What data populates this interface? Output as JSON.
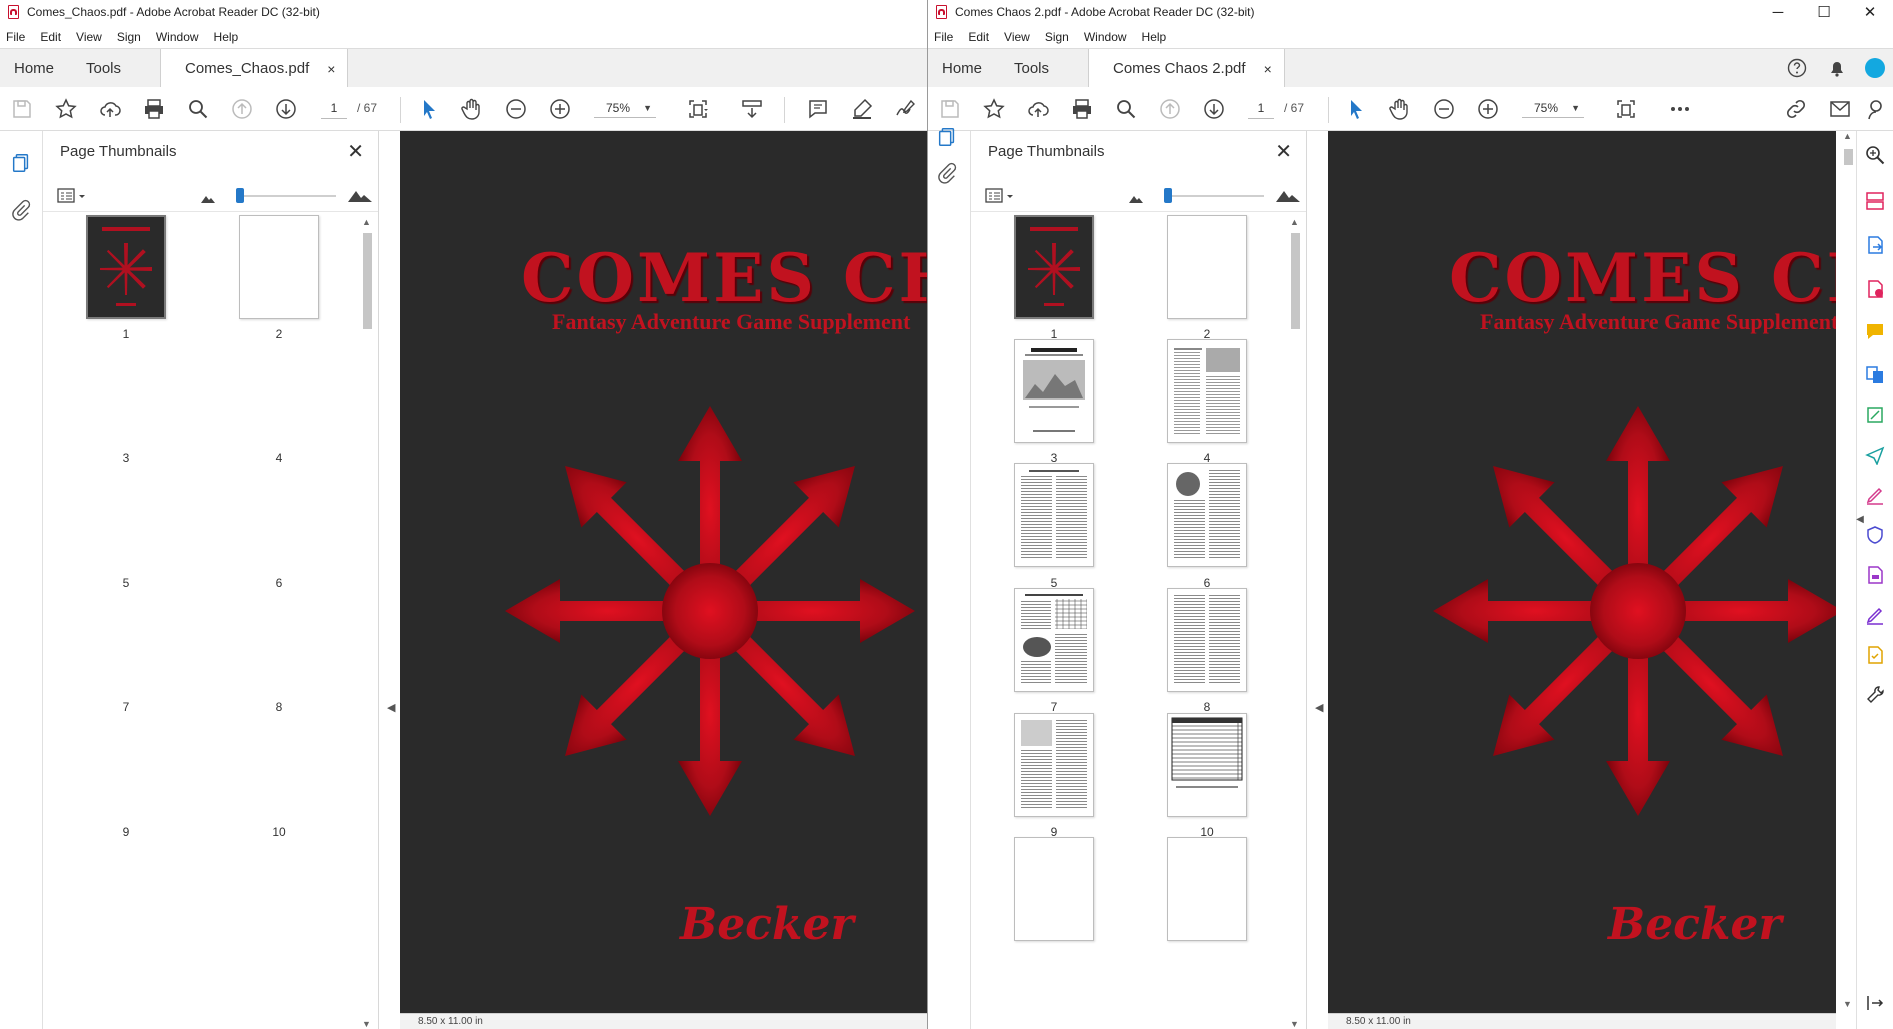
{
  "colors": {
    "accent_blue": "#2478c8",
    "cover_red": "#c1121f",
    "cover_bg": "#2a2a2a"
  },
  "left_window": {
    "title": "Comes_Chaos.pdf - Adobe Acrobat Reader DC (32-bit)",
    "menu": [
      "File",
      "Edit",
      "View",
      "Sign",
      "Window",
      "Help"
    ],
    "tabs": {
      "home": "Home",
      "tools": "Tools",
      "doc": "Comes_Chaos.pdf",
      "close": "×"
    },
    "toolbar": {
      "page_current": "1",
      "page_total": "/ 67",
      "zoom": "75%"
    },
    "panel": {
      "title": "Page Thumbnails",
      "close": "✕",
      "thumbnails": [
        "1",
        "2",
        "3",
        "4",
        "5",
        "6",
        "7",
        "8",
        "9",
        "10"
      ]
    },
    "cover": {
      "title": "COMES CHAOS",
      "subtitle": "Fantasy Adventure Game Supplement",
      "author": "Becker"
    },
    "page_size": "8.50 x 11.00 in"
  },
  "right_window": {
    "title": "Comes Chaos 2.pdf - Adobe Acrobat Reader DC (32-bit)",
    "menu": [
      "File",
      "Edit",
      "View",
      "Sign",
      "Window",
      "Help"
    ],
    "tabs": {
      "home": "Home",
      "tools": "Tools",
      "doc": "Comes Chaos 2.pdf",
      "close": "×"
    },
    "toolbar": {
      "page_current": "1",
      "page_total": "/ 67",
      "zoom": "75%"
    },
    "panel": {
      "title": "Page Thumbnails",
      "close": "✕",
      "thumbnails": [
        "1",
        "2",
        "3",
        "4",
        "5",
        "6",
        "7",
        "8",
        "9",
        "10"
      ]
    },
    "cover": {
      "title": "COMES CHAOS",
      "subtitle": "Fantasy Adventure Game Supplement",
      "author": "Becker"
    },
    "page_size": "8.50 x 11.00 in",
    "window_controls": {
      "minimize": "─",
      "maximize": "☐",
      "close": "✕"
    }
  }
}
